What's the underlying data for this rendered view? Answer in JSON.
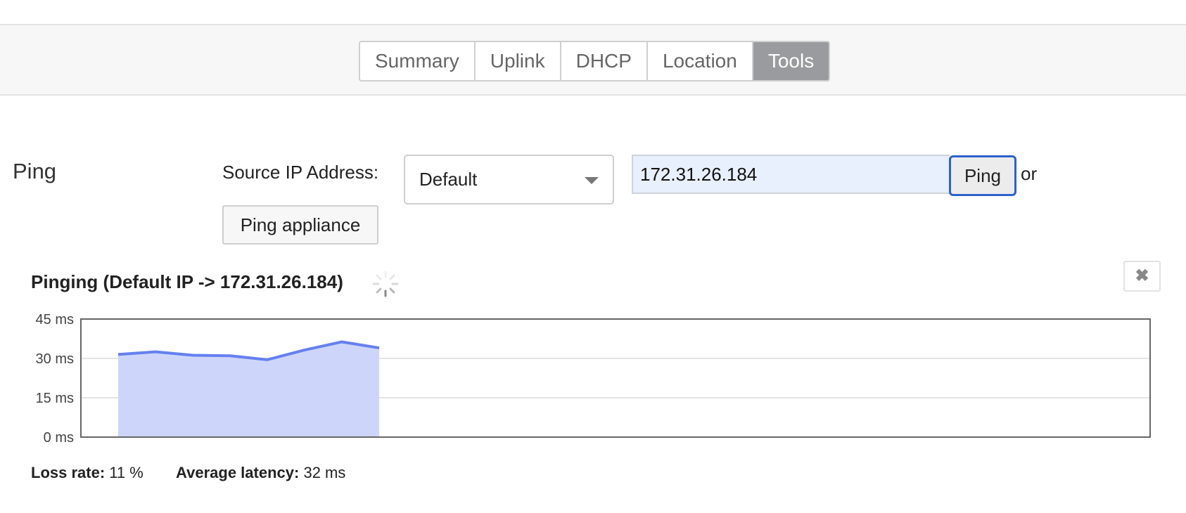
{
  "tabs": [
    {
      "label": "Summary",
      "active": false
    },
    {
      "label": "Uplink",
      "active": false
    },
    {
      "label": "DHCP",
      "active": false
    },
    {
      "label": "Location",
      "active": false
    },
    {
      "label": "Tools",
      "active": true
    }
  ],
  "ping": {
    "section_label": "Ping",
    "source_label": "Source IP Address:",
    "source_selected": "Default",
    "target_value": "172.31.26.184",
    "ping_button": "Ping",
    "or_text": "or",
    "appliance_button": "Ping appliance",
    "status_title": "Pinging (Default IP -> 172.31.26.184)",
    "close_glyph": "✖"
  },
  "stats": {
    "loss_label": "Loss rate:",
    "loss_value": "11 %",
    "latency_label": "Average latency:",
    "latency_value": "32 ms"
  },
  "colors": {
    "accent": "#2c62c9",
    "line": "#6580f0",
    "fill": "#cdd6fa",
    "active_tab": "#9a9b9e"
  },
  "icons": {
    "dropdown": "chevron-down-icon",
    "spinner": "loading-spinner-icon",
    "close": "close-icon"
  },
  "chart_data": {
    "type": "area",
    "title": "",
    "xlabel": "",
    "ylabel": "",
    "ylim": [
      0,
      45
    ],
    "yticks": [
      0,
      15,
      30,
      45
    ],
    "ytick_labels": [
      "0 ms",
      "15 ms",
      "30 ms",
      "45 ms"
    ],
    "x_total_slots": 30,
    "x": [
      0,
      1,
      2,
      3,
      4,
      5,
      6,
      7
    ],
    "series": [
      {
        "values": [
          31.5,
          32.5,
          31.2,
          31.0,
          29.5,
          33.2,
          36.3,
          34.0
        ]
      }
    ],
    "grid": true
  }
}
